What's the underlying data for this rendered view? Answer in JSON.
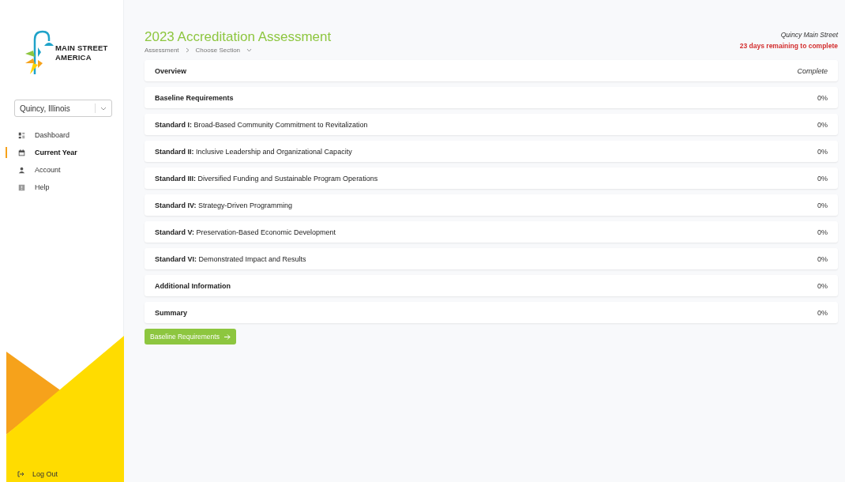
{
  "logo": {
    "lines": [
      "MAIN STREET",
      "AMERICA"
    ]
  },
  "location_select": {
    "value": "Quincy, Illinois"
  },
  "nav": [
    {
      "label": "Dashboard",
      "selected": false
    },
    {
      "label": "Current Year",
      "selected": true
    },
    {
      "label": "Account",
      "selected": false
    },
    {
      "label": "Help",
      "selected": false
    }
  ],
  "logout": {
    "label": "Log Out"
  },
  "header": {
    "title": "2023 Accreditation Assessment",
    "breadcrumb": [
      "Assessment",
      "Choose Section"
    ],
    "organization": "Quincy Main Street",
    "deadline": "23 days remaining to complete"
  },
  "sections": [
    {
      "label": "Overview",
      "kind": "part",
      "status": "Complete",
      "done": true
    },
    {
      "label": "Baseline Requirements",
      "kind": "part",
      "status": "0%",
      "done": false
    },
    {
      "label": "**Standard I:** Broad-Based Community Commitment to Revitalization",
      "kind": "standard",
      "status": "0%",
      "done": false
    },
    {
      "label": "**Standard II:** Inclusive Leadership and Organizational Capacity",
      "kind": "standard",
      "status": "0%",
      "done": false
    },
    {
      "label": "**Standard III:** Diversified Funding and Sustainable Program Operations",
      "kind": "standard",
      "status": "0%",
      "done": false
    },
    {
      "label": "**Standard IV:** Strategy-Driven Programming",
      "kind": "standard",
      "status": "0%",
      "done": false
    },
    {
      "label": "**Standard V:** Preservation-Based Economic Development",
      "kind": "standard",
      "status": "0%",
      "done": false
    },
    {
      "label": "**Standard VI:** Demonstrated Impact and Results",
      "kind": "standard",
      "status": "0%",
      "done": false
    },
    {
      "label": "Additional Information",
      "kind": "part",
      "status": "0%",
      "done": false
    },
    {
      "label": "Summary",
      "kind": "part",
      "status": "0%",
      "done": false
    }
  ],
  "next_button": {
    "label": "Baseline Requirements"
  }
}
